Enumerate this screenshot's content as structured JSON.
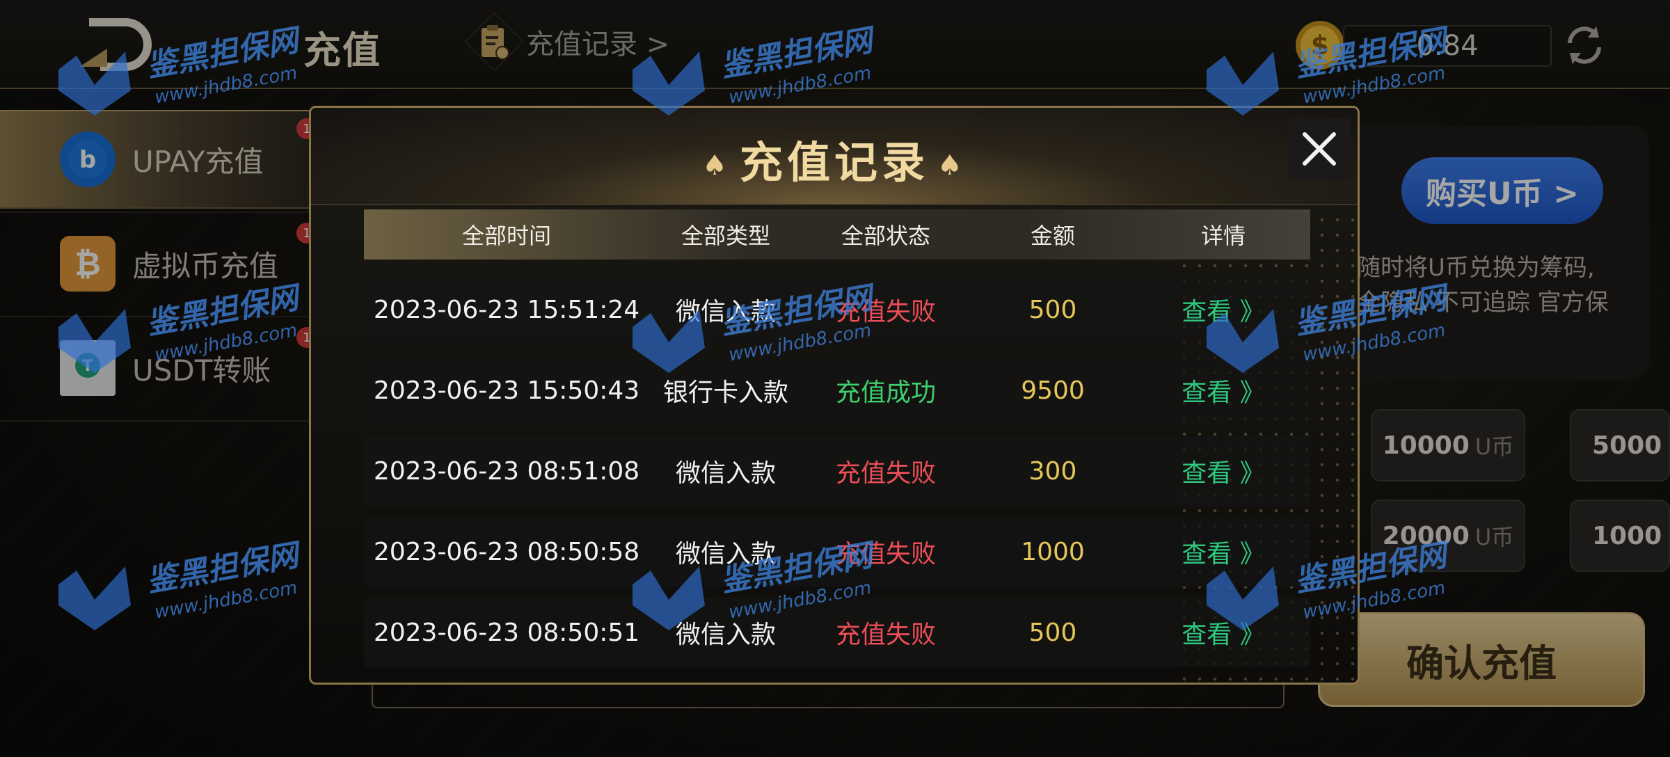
{
  "header": {
    "title": "充值",
    "record_link": "充值记录 >",
    "balance": "0.84"
  },
  "sidebar": {
    "items": [
      {
        "label": "UPAY充值",
        "icon": "upay-logo-icon",
        "active": true
      },
      {
        "label": "虚拟币充值",
        "icon": "bitcoin-icon",
        "active": false
      },
      {
        "label": "USDT转账",
        "icon": "tether-icon",
        "active": false
      }
    ]
  },
  "right_panel": {
    "buy_button": "购买U币 >",
    "description_line1": "随时将U币兑换为筹码,",
    "description_line2": "全隐私 不可追踪 官方保",
    "amounts": [
      {
        "value": "10000",
        "unit": "U币"
      },
      {
        "value": "5000",
        "unit": ""
      },
      {
        "value": "20000",
        "unit": "U币"
      },
      {
        "value": "1000",
        "unit": ""
      }
    ],
    "confirm_button": "确认充值"
  },
  "modal": {
    "title": "充值记录",
    "columns": [
      "全部时间",
      "全部类型",
      "全部状态",
      "金额",
      "详情"
    ],
    "rows": [
      {
        "time": "2023-06-23 15:51:24",
        "type": "微信入款",
        "status": "充值失败",
        "status_kind": "fail",
        "amount": "500",
        "detail": "查看 》"
      },
      {
        "time": "2023-06-23 15:50:43",
        "type": "银行卡入款",
        "status": "充值成功",
        "status_kind": "ok",
        "amount": "9500",
        "detail": "查看 》"
      },
      {
        "time": "2023-06-23 08:51:08",
        "type": "微信入款",
        "status": "充值失败",
        "status_kind": "fail",
        "amount": "300",
        "detail": "查看 》"
      },
      {
        "time": "2023-06-23 08:50:58",
        "type": "微信入款",
        "status": "充值失败",
        "status_kind": "fail",
        "amount": "1000",
        "detail": "查看 》"
      },
      {
        "time": "2023-06-23 08:50:51",
        "type": "微信入款",
        "status": "充值失败",
        "status_kind": "fail",
        "amount": "500",
        "detail": "查看 》"
      }
    ]
  },
  "watermark": {
    "title": "鉴黑担保网",
    "url": "www.jhdb8.com"
  },
  "colors": {
    "accent_gold": "#f1d9a2",
    "fail_red": "#ee4e58",
    "success_green": "#3fd06d",
    "detail_green": "#2fc87e",
    "amount_yellow": "#e6c75a",
    "buy_blue": "#2f6fe0"
  }
}
